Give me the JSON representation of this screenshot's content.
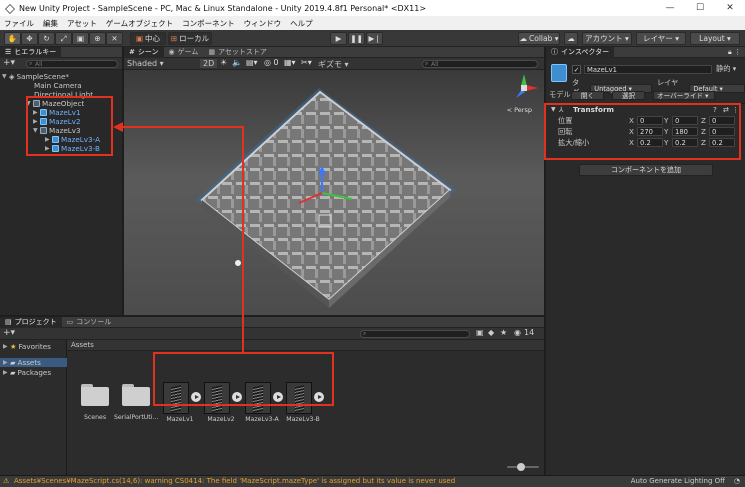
{
  "window": {
    "title": "New Unity Project - SampleScene - PC, Mac & Linux Standalone - Unity 2019.4.8f1 Personal* <DX11>",
    "controls": [
      "—",
      "☐",
      "✕"
    ]
  },
  "menu": [
    "ファイル",
    "編集",
    "アセット",
    "ゲームオブジェクト",
    "コンポーネント",
    "ウィンドウ",
    "ヘルプ"
  ],
  "toolbar": {
    "pivot_label": "中心",
    "space_label": "ローカル",
    "collab_label": "Collab ▾",
    "account_label": "アカウント ▾",
    "layers_label": "レイヤー ▾",
    "layout_label": "Layout ▾"
  },
  "hierarchy": {
    "tab": "ヒエラルキー",
    "search_placeholder": "All",
    "items": [
      {
        "label": "SampleScene*"
      },
      {
        "label": "Main Camera"
      },
      {
        "label": "Directional Light"
      },
      {
        "label": "MazeObject"
      },
      {
        "label": "MazeLv1"
      },
      {
        "label": "MazeLv2"
      },
      {
        "label": "MazeLv3"
      },
      {
        "label": "MazeLv3-A"
      },
      {
        "label": "MazeLv3-B"
      }
    ]
  },
  "scene": {
    "tabs": [
      "シーン",
      "ゲーム",
      "アセットストア"
    ],
    "shading": "Shaded",
    "mode_2d": "2D",
    "gizmos": "ギズモ ▾",
    "search_placeholder": "All",
    "persp_label": "< Persp"
  },
  "inspector": {
    "tab": "インスペクター",
    "object_name": "MazeLv1",
    "static_label": "静的 ▾",
    "tag_label": "タグ",
    "tag_value": "Untagged",
    "layer_label": "レイヤー",
    "layer_value": "Default",
    "model_label": "モデル",
    "open_label": "開く",
    "select_label": "選択",
    "override_label": "オーバーライド ▾",
    "transform_title": "Transform",
    "rows": [
      {
        "label": "位置",
        "x": "0",
        "y": "0",
        "z": "0"
      },
      {
        "label": "回転",
        "x": "270",
        "y": "180",
        "z": "0"
      },
      {
        "label": "拡大/縮小",
        "x": "0.2",
        "y": "0.2",
        "z": "0.2"
      }
    ],
    "axis_x": "X",
    "axis_y": "Y",
    "axis_z": "Z",
    "add_component": "コンポーネントを追加"
  },
  "project": {
    "tabs": [
      "プロジェクト",
      "コンソール"
    ],
    "badge": "14",
    "tree": [
      "Favorites",
      "Assets",
      "Packages"
    ],
    "breadcrumb": "Assets",
    "assets": [
      {
        "label": "Scenes"
      },
      {
        "label": "SerialPortUti..."
      },
      {
        "label": "MazeLv1"
      },
      {
        "label": "MazeLv2"
      },
      {
        "label": "MazeLv3-A"
      },
      {
        "label": "MazeLv3-B"
      }
    ]
  },
  "status": {
    "warning": "Assets¥Scenes¥MazeScript.cs(14,6): warning CS0414: The field 'MazeScript.mazeType' is assigned but its value is never used",
    "right": "Auto Generate Lighting Off"
  },
  "colors": {
    "highlight": "#e0321e",
    "selection": "#6fb3ff"
  }
}
